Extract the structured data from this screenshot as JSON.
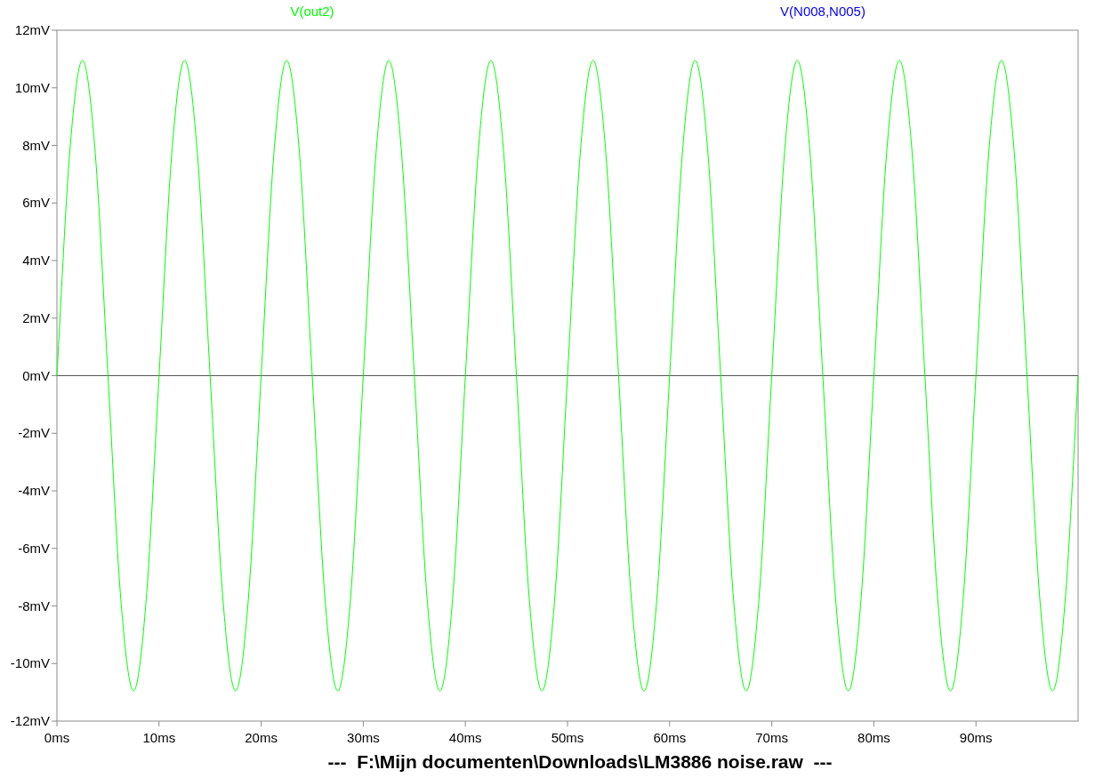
{
  "plot": {
    "trace_labels": [
      {
        "label": "V(out2)",
        "color": "#00ff00"
      },
      {
        "label": "V(N008,N005)",
        "color": "#0000ff"
      }
    ],
    "chart_data": {
      "type": "line",
      "x": [
        0,
        1.25,
        2.5,
        3.75,
        5,
        6.25,
        7.5,
        8.75,
        10,
        11.25,
        12.5,
        13.75,
        15,
        16.25,
        17.5,
        18.75,
        20,
        21.25,
        22.5,
        23.75,
        25,
        26.25,
        27.5,
        28.75,
        30,
        31.25,
        32.5,
        33.75,
        35,
        36.25,
        37.5,
        38.75,
        40,
        41.25,
        42.5,
        43.75,
        45,
        46.25,
        47.5,
        48.75,
        50,
        51.25,
        52.5,
        53.75,
        55,
        56.25,
        57.5,
        58.75,
        60,
        61.25,
        62.5,
        63.75,
        65,
        66.25,
        67.5,
        68.75,
        70,
        71.25,
        72.5,
        73.75,
        75,
        76.25,
        77.5,
        78.75,
        80,
        81.25,
        82.5,
        83.75,
        85,
        86.25,
        87.5,
        88.75,
        90,
        91.25,
        92.5,
        93.75,
        95,
        96.25,
        97.5,
        98.75,
        100
      ],
      "series": [
        {
          "color": "#00ff00",
          "values": [
            0,
            7.74,
            10.95,
            7.74,
            0,
            -7.74,
            -10.95,
            -7.74,
            0,
            7.74,
            10.95,
            7.74,
            0,
            -7.74,
            -10.95,
            -7.74,
            0,
            7.74,
            10.95,
            7.74,
            0,
            -7.74,
            -10.95,
            -7.74,
            0,
            7.74,
            10.95,
            7.74,
            0,
            -7.74,
            -10.95,
            -7.74,
            0,
            7.74,
            10.95,
            7.74,
            0,
            -7.74,
            -10.95,
            -7.74,
            0,
            7.74,
            10.95,
            7.74,
            0,
            -7.74,
            -10.95,
            -7.74,
            0,
            7.74,
            10.95,
            7.74,
            0,
            -7.74,
            -10.95,
            -7.74,
            0,
            7.74,
            10.95,
            7.74,
            0,
            -7.74,
            -10.95,
            -7.74,
            0,
            7.74,
            10.95,
            7.74,
            0,
            -7.74,
            -10.95,
            -7.74,
            0,
            7.74,
            10.95,
            7.74,
            0,
            -7.74,
            -10.95,
            -7.74,
            0
          ]
        }
      ],
      "xlim": [
        0,
        100
      ],
      "ylim": [
        -12,
        12
      ],
      "xticks": [
        {
          "value": 0,
          "label": "0ms"
        },
        {
          "value": 10,
          "label": "10ms"
        },
        {
          "value": 20,
          "label": "20ms"
        },
        {
          "value": 30,
          "label": "30ms"
        },
        {
          "value": 40,
          "label": "40ms"
        },
        {
          "value": 50,
          "label": "50ms"
        },
        {
          "value": 60,
          "label": "60ms"
        },
        {
          "value": 70,
          "label": "70ms"
        },
        {
          "value": 80,
          "label": "80ms"
        },
        {
          "value": 90,
          "label": "90ms"
        }
      ],
      "yticks": [
        {
          "value": 12,
          "label": "12mV"
        },
        {
          "value": 10,
          "label": "10mV"
        },
        {
          "value": 8,
          "label": "8mV"
        },
        {
          "value": 6,
          "label": "6mV"
        },
        {
          "value": 4,
          "label": "4mV"
        },
        {
          "value": 2,
          "label": "2mV"
        },
        {
          "value": 0,
          "label": "0mV"
        },
        {
          "value": -2,
          "label": "-2mV"
        },
        {
          "value": -4,
          "label": "-4mV"
        },
        {
          "value": -6,
          "label": "-6mV"
        },
        {
          "value": -8,
          "label": "-8mV"
        },
        {
          "value": -10,
          "label": "-10mV"
        },
        {
          "value": -12,
          "label": "-12mV"
        }
      ]
    }
  },
  "footer": {
    "title": "---  F:\\Mijn documenten\\Downloads\\LM3886 noise.raw  ---"
  }
}
